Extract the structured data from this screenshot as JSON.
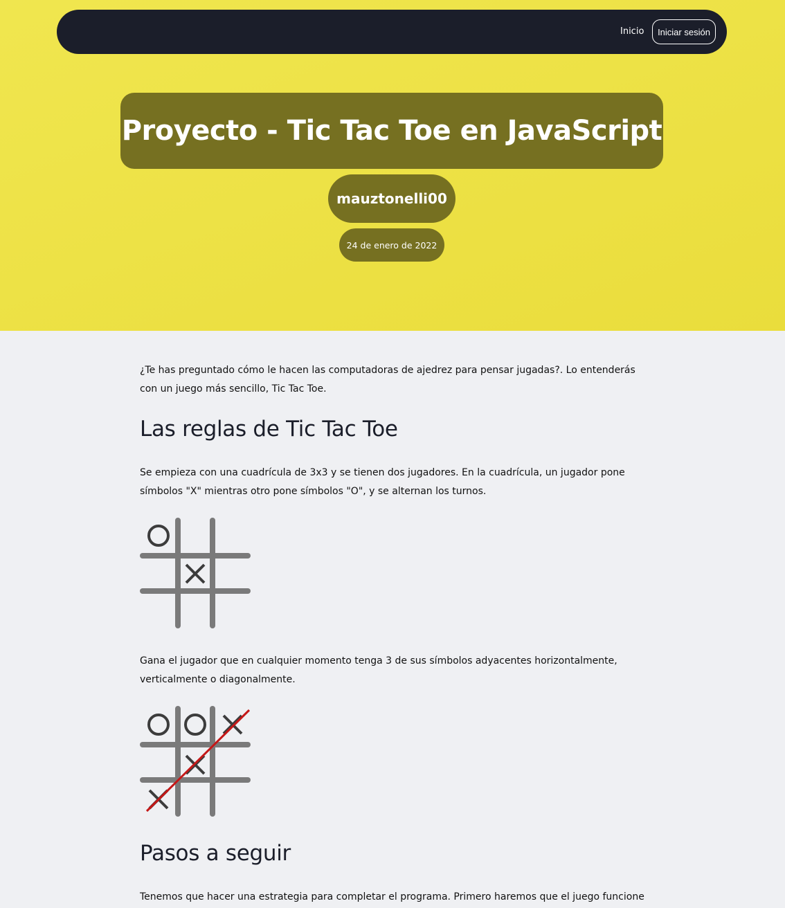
{
  "nav": {
    "home_label": "Inicio",
    "login_label": "Iniciar sesión"
  },
  "hero": {
    "title": "Proyecto - Tic Tac Toe en JavaScript",
    "author": "mauztonelli00",
    "date": "24 de enero de 2022"
  },
  "article": {
    "intro": "¿Te has preguntado cómo le hacen las computadoras de ajedrez para pensar jugadas?. Lo entenderás con un juego más sencillo, Tic Tac Toe.",
    "heading_rules": "Las reglas de Tic Tac Toe",
    "rules_text": "Se empieza con una cuadrícula de 3x3 y se tienen dos jugadores. En la cuadrícula, un jugador pone símbolos \"X\" mientras otro pone símbolos \"O\", y se alternan los turnos.",
    "win_text": "Gana el jugador que en cualquier momento tenga 3 de sus símbolos adyacentes horizontalmente, verticalmente o diagonalmente.",
    "heading_steps": "Pasos a seguir",
    "steps_text": "Tenemos que hacer una estrategia para completar el programa. Primero haremos que el juego funcione con dos"
  },
  "colors": {
    "hero_bg": "#eee44a",
    "navbar_bg": "#1b1e2a",
    "pill_bg": "#767021",
    "page_bg": "#eff0f3",
    "grid_line": "#7a7a7a",
    "symbol": "#3c3c3c",
    "win_line": "#c41818"
  }
}
